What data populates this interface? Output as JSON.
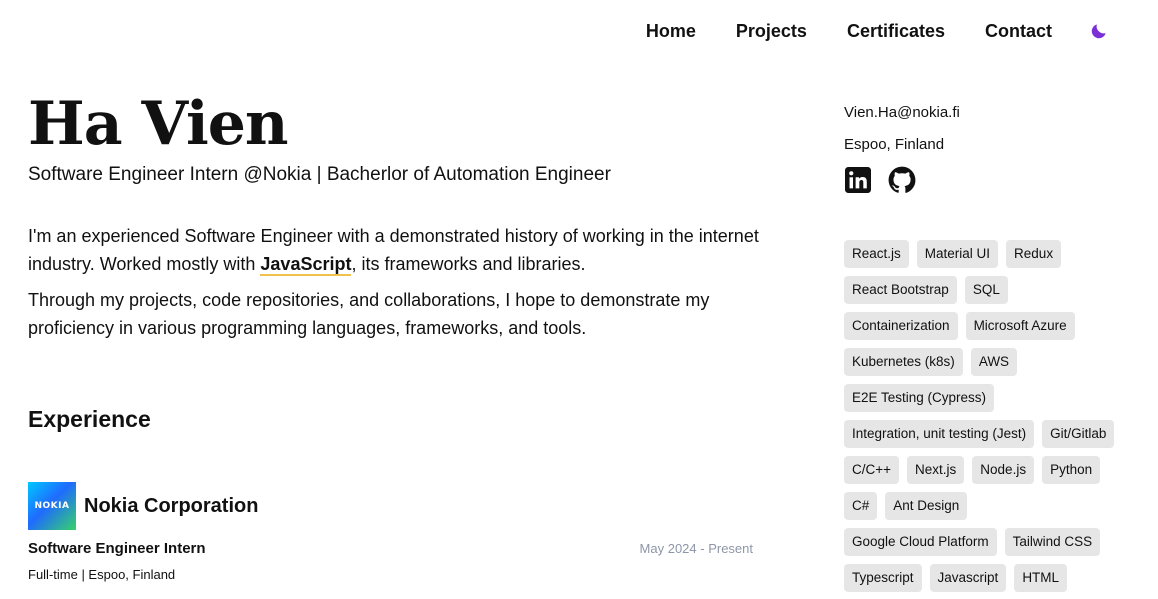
{
  "nav": {
    "items": [
      {
        "label": "Home"
      },
      {
        "label": "Projects"
      },
      {
        "label": "Certificates"
      },
      {
        "label": "Contact"
      }
    ],
    "theme_icon": "moon-icon",
    "theme_color": "#7b2fd6"
  },
  "profile": {
    "name": "Ha Vien",
    "tagline": "Software Engineer Intern @Nokia | Bacherlor of Automation Engineer",
    "bio_1_before": "I'm an experienced Software Engineer with a demonstrated history of working in the internet industry. Worked mostly with ",
    "bio_1_highlight": "JavaScript",
    "bio_1_after": ", its frameworks and libraries.",
    "bio_2": "Through my projects, code repositories, and collaborations, I hope to demonstrate my proficiency in various programming languages, frameworks, and tools."
  },
  "experience": {
    "title": "Experience",
    "items": [
      {
        "company": "Nokia Corporation",
        "logo_text": "NOKIA",
        "role": "Software Engineer Intern",
        "dates": "May 2024 - Present",
        "employment": "Full-time | Espoo, Finland"
      }
    ]
  },
  "sidebar": {
    "email": "Vien.Ha@nokia.fi",
    "location": "Espoo, Finland",
    "socials": [
      {
        "icon": "linkedin-icon"
      },
      {
        "icon": "github-icon"
      }
    ],
    "skills": [
      "React.js",
      "Material UI",
      "Redux",
      "React Bootstrap",
      "SQL",
      "Containerization",
      "Microsoft Azure",
      "Kubernetes (k8s)",
      "AWS",
      "E2E Testing (Cypress)",
      "Integration, unit testing (Jest)",
      "Git/Gitlab",
      "C/C++",
      "Next.js",
      "Node.js",
      "Python",
      "C#",
      "Ant Design",
      "Google Cloud Platform",
      "Tailwind CSS",
      "Typescript",
      "Javascript",
      "HTML"
    ]
  },
  "colors": {
    "highlight_underline": "#f0c24b",
    "chip_bg": "#e6e6e6",
    "date_text": "#8d96a8"
  }
}
